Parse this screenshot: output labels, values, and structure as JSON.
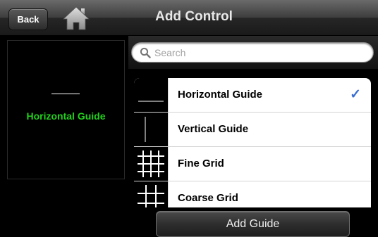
{
  "navbar": {
    "back_label": "Back",
    "title": "Add Control",
    "home_icon": "home-icon"
  },
  "preview": {
    "label": "Horizontal Guide",
    "label_color": "#21d11c"
  },
  "search": {
    "placeholder": "Search",
    "value": ""
  },
  "list": {
    "items": [
      {
        "label": "Horizontal Guide",
        "icon": "horizontal-line-icon",
        "selected": true
      },
      {
        "label": "Vertical Guide",
        "icon": "vertical-line-icon",
        "selected": false
      },
      {
        "label": "Fine Grid",
        "icon": "fine-grid-icon",
        "selected": false
      },
      {
        "label": "Coarse Grid",
        "icon": "coarse-grid-icon",
        "selected": false
      }
    ],
    "check_mark": "✓",
    "check_color": "#3a6fd1"
  },
  "action": {
    "label": "Add Guide"
  }
}
